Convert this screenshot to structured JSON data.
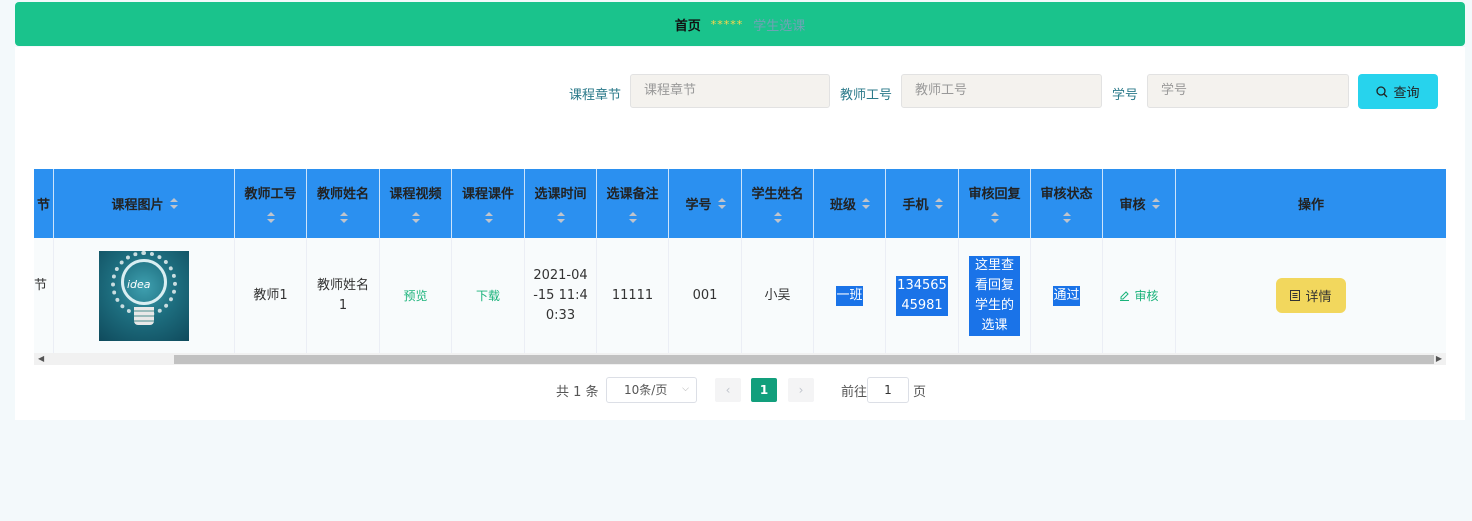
{
  "breadcrumb": {
    "home": "首页",
    "separator": "*****",
    "current": "学生选课"
  },
  "search": {
    "fields": [
      {
        "label": "课程章节",
        "placeholder": "课程章节"
      },
      {
        "label": "教师工号",
        "placeholder": "教师工号"
      },
      {
        "label": "学号",
        "placeholder": "学号"
      }
    ],
    "query_label": "查询"
  },
  "table": {
    "columns": [
      "节",
      "课程图片",
      "教师工号",
      "教师姓名",
      "课程视频",
      "课程课件",
      "选课时间",
      "选课备注",
      "学号",
      "学生姓名",
      "班级",
      "手机",
      "审核回复",
      "审核状态",
      "审核",
      "操作"
    ],
    "row": {
      "chapter": "节",
      "image_text": "idea",
      "teacher_id": "教师1",
      "teacher_name": "教师姓名1",
      "video": "预览",
      "courseware": "下载",
      "time": "2021-04-15 11:40:33",
      "remark": "11111",
      "student_id": "001",
      "student_name": "小吴",
      "class": "一班",
      "phone": "13456545981",
      "reply": "这里查看回复学生的选课",
      "status": "通过",
      "audit": "审核",
      "detail": "详情"
    }
  },
  "pagination": {
    "total": "共 1 条",
    "page_size": "10条/页",
    "current_page": "1",
    "goto_prefix": "前往",
    "goto_value": "1",
    "goto_suffix": "页"
  },
  "colors": {
    "topbar": "#1ac38c",
    "header": "#2b90f0",
    "query": "#27d3ed",
    "detail": "#f2d75d",
    "page": "#129f7c"
  }
}
